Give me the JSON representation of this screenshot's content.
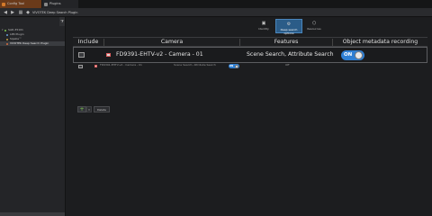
{
  "tabs": [
    {
      "label": "Config Tool",
      "icon": "config-tool-icon"
    },
    {
      "label": "Plugins",
      "icon": "plugins-icon"
    }
  ],
  "toolbar": {
    "title": "VIVOTEK Deep Search Plugin"
  },
  "tree": {
    "items": [
      {
        "label": "SAD-35101"
      },
      {
        "label": "LPR Plugin"
      },
      {
        "label": "Sipelia™"
      },
      {
        "label": "VIVOTEK Deep Search Plugin"
      }
    ]
  },
  "plugin_tabs": [
    {
      "label": "Identity",
      "icon": "identity-icon"
    },
    {
      "label": "Deep search options",
      "icon": "deep-search-options-icon"
    },
    {
      "label": "Resources",
      "icon": "resources-icon"
    }
  ],
  "table": {
    "headers": [
      "Include",
      "Camera",
      "Features",
      "Object metadata recording"
    ],
    "rows": [
      {
        "camera": "FD9391-EHTV-v2 - Camera - 01",
        "features": "Scene Search, Attribute Search",
        "recording": "ON"
      },
      {
        "camera": "FD9391-EHTV-v2 - Camera - 01",
        "features": "Scene Search, Attribute Search",
        "recording": "ON",
        "recording_alt": "Off"
      }
    ]
  },
  "actions": {
    "delete_label": "Delete"
  },
  "colors": {
    "accent": "#2f7fd3",
    "config_tab": "#6a3a1a"
  }
}
